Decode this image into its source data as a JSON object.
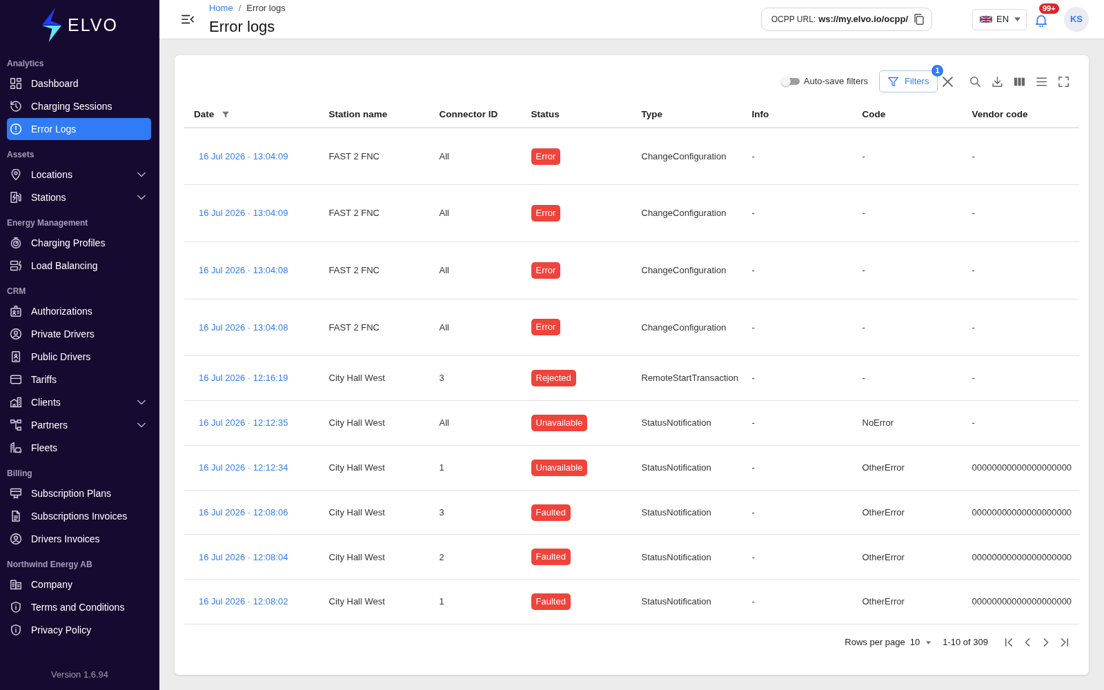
{
  "sidebar": {
    "logo": "ELVO",
    "sections": [
      {
        "title": "Analytics",
        "items": [
          {
            "label": "Dashboard",
            "kind": "link",
            "selected": false
          },
          {
            "label": "Charging Sessions",
            "kind": "link",
            "selected": false
          },
          {
            "label": "Error Logs",
            "kind": "link",
            "selected": true
          }
        ]
      },
      {
        "title": "Assets",
        "items": [
          {
            "label": "Locations",
            "kind": "group",
            "selected": false,
            "expanded": false
          },
          {
            "label": "Stations",
            "kind": "group",
            "selected": false,
            "expanded": false
          }
        ]
      },
      {
        "title": "Energy Management",
        "items": [
          {
            "label": "Charging Profiles",
            "kind": "link",
            "selected": false
          },
          {
            "label": "Load Balancing",
            "kind": "link",
            "selected": false
          }
        ]
      },
      {
        "title": "CRM",
        "items": [
          {
            "label": "Authorizations",
            "kind": "link",
            "selected": false
          },
          {
            "label": "Private Drivers",
            "kind": "link",
            "selected": false
          },
          {
            "label": "Public Drivers",
            "kind": "link",
            "selected": false
          },
          {
            "label": "Tariffs",
            "kind": "link",
            "selected": false
          },
          {
            "label": "Clients",
            "kind": "group",
            "selected": false,
            "expanded": false
          },
          {
            "label": "Partners",
            "kind": "group",
            "selected": false,
            "expanded": false
          },
          {
            "label": "Fleets",
            "kind": "link",
            "selected": false
          }
        ]
      },
      {
        "title": "Billing",
        "items": [
          {
            "label": "Subscription Plans",
            "kind": "link",
            "selected": false
          },
          {
            "label": "Subscriptions Invoices",
            "kind": "link",
            "selected": false
          },
          {
            "label": "Drivers Invoices",
            "kind": "link",
            "selected": false
          }
        ]
      },
      {
        "title": "Northwind Energy AB",
        "items": [
          {
            "label": "Company",
            "kind": "link",
            "selected": false
          },
          {
            "label": "Terms and Conditions",
            "kind": "link",
            "selected": false
          },
          {
            "label": "Privacy Policy",
            "kind": "link",
            "selected": false
          }
        ]
      }
    ],
    "version": "Version 1.6.94"
  },
  "header": {
    "breadcrumb": {
      "items": [
        {
          "label": "Home",
          "kind": "link"
        },
        {
          "label": "Error logs",
          "kind": "current"
        }
      ],
      "separator": "/"
    },
    "title": "Error logs",
    "ocpp_url": {
      "label": "OCPP URL:",
      "value": "ws://my.elvo.io/ocpp/"
    },
    "language": "EN",
    "notifications_count": "99+",
    "avatar_initials": "KS"
  },
  "toolbar": {
    "auto_save_filters": {
      "label": "Auto-save filters",
      "on": false
    },
    "filters_button": {
      "label": "Filters",
      "count": "1"
    }
  },
  "table": {
    "columns": [
      {
        "label": "Date",
        "filtered": true
      },
      {
        "label": "Station name",
        "filtered": false
      },
      {
        "label": "Connector ID",
        "filtered": false
      },
      {
        "label": "Status",
        "filtered": false
      },
      {
        "label": "Type",
        "filtered": false
      },
      {
        "label": "Info",
        "filtered": false
      },
      {
        "label": "Code",
        "filtered": false
      },
      {
        "label": "Vendor code",
        "filtered": false
      }
    ],
    "rows": [
      {
        "date": "16 Jul 2026 · 13:04:09",
        "station_name": "FAST 2 FNC",
        "connector_id": "All",
        "status": "Error",
        "type": "ChangeConfiguration",
        "info": "-",
        "code": "-",
        "vendor_code": "-"
      },
      {
        "date": "16 Jul 2026 · 13:04:09",
        "station_name": "FAST 2 FNC",
        "connector_id": "All",
        "status": "Error",
        "type": "ChangeConfiguration",
        "info": "-",
        "code": "-",
        "vendor_code": "-"
      },
      {
        "date": "16 Jul 2026 · 13:04:08",
        "station_name": "FAST 2 FNC",
        "connector_id": "All",
        "status": "Error",
        "type": "ChangeConfiguration",
        "info": "-",
        "code": "-",
        "vendor_code": "-"
      },
      {
        "date": "16 Jul 2026 · 13:04:08",
        "station_name": "FAST 2 FNC",
        "connector_id": "All",
        "status": "Error",
        "type": "ChangeConfiguration",
        "info": "-",
        "code": "-",
        "vendor_code": "-"
      },
      {
        "date": "16 Jul 2026 · 12:16:19",
        "station_name": "City Hall West",
        "connector_id": "3",
        "status": "Rejected",
        "type": "RemoteStartTransaction",
        "info": "-",
        "code": "-",
        "vendor_code": "-"
      },
      {
        "date": "16 Jul 2026 · 12:12:35",
        "station_name": "City Hall West",
        "connector_id": "All",
        "status": "Unavailable",
        "type": "StatusNotification",
        "info": "-",
        "code": "NoError",
        "vendor_code": "-"
      },
      {
        "date": "16 Jul 2026 · 12:12:34",
        "station_name": "City Hall West",
        "connector_id": "1",
        "status": "Unavailable",
        "type": "StatusNotification",
        "info": "-",
        "code": "OtherError",
        "vendor_code": "00000000000000000000"
      },
      {
        "date": "16 Jul 2026 · 12:08:06",
        "station_name": "City Hall West",
        "connector_id": "3",
        "status": "Faulted",
        "type": "StatusNotification",
        "info": "-",
        "code": "OtherError",
        "vendor_code": "00000000000000000000"
      },
      {
        "date": "16 Jul 2026 · 12:08:04",
        "station_name": "City Hall West",
        "connector_id": "2",
        "status": "Faulted",
        "type": "StatusNotification",
        "info": "-",
        "code": "OtherError",
        "vendor_code": "00000000000000000000"
      },
      {
        "date": "16 Jul 2026 · 12:08:02",
        "station_name": "City Hall West",
        "connector_id": "1",
        "status": "Faulted",
        "type": "StatusNotification",
        "info": "-",
        "code": "OtherError",
        "vendor_code": "00000000000000000000"
      }
    ]
  },
  "pagination": {
    "rows_per_page_label": "Rows per page",
    "rows_per_page": "10",
    "range": "1-10 of 309"
  }
}
